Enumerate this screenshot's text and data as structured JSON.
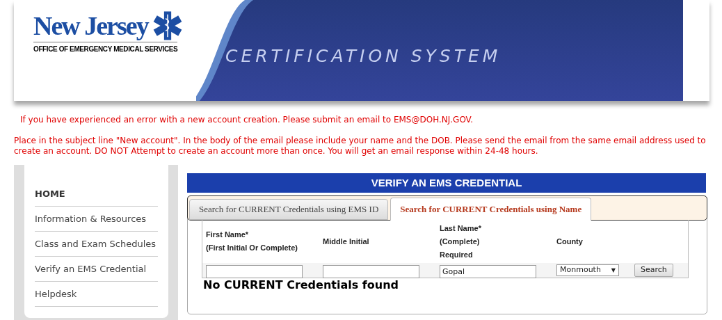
{
  "header": {
    "logo_title": "New Jersey",
    "logo_subtitle": "OFFICE OF EMERGENCY MEDICAL SERVICES",
    "system_title": "CERTIFICATION SYSTEM"
  },
  "notices": [
    "If you have experienced an error with a new account creation. Please submit an email to EMS@DOH.NJ.GOV.",
    "Place in the subject line \"New account\". In the body of the email please include your name and the DOB. Please send the email from the same email address used to create an account. DO NOT Attempt to create an account more than once. You will get an email response within 24-48 hours."
  ],
  "sidebar": {
    "items": [
      {
        "label": "HOME",
        "selected": true
      },
      {
        "label": "Information & Resources",
        "selected": false
      },
      {
        "label": "Class and Exam Schedules",
        "selected": false
      },
      {
        "label": "Verify an EMS Credential",
        "selected": false
      },
      {
        "label": "Helpdesk",
        "selected": false
      }
    ]
  },
  "panel": {
    "title": "VERIFY AN EMS CREDENTIAL",
    "tabs": [
      {
        "label": "Search for CURRENT Credentials using EMS ID",
        "selected": false
      },
      {
        "label": "Search for CURRENT Credentials using Name",
        "selected": true
      }
    ],
    "fields": [
      {
        "kind": "text",
        "label": [
          "First Name*",
          "(First Initial Or Complete)"
        ]
      },
      {
        "kind": "text",
        "label": [
          "Middle Initial"
        ]
      },
      {
        "kind": "text",
        "label": [
          "Last Name*",
          "(Complete)",
          "Required"
        ],
        "value": "Gopal"
      },
      {
        "kind": "select",
        "label": [
          "County"
        ],
        "value": "Monmouth",
        "arrow": "▼"
      }
    ],
    "search_button": "Search",
    "result": "No CURRENT Credentials found"
  }
}
